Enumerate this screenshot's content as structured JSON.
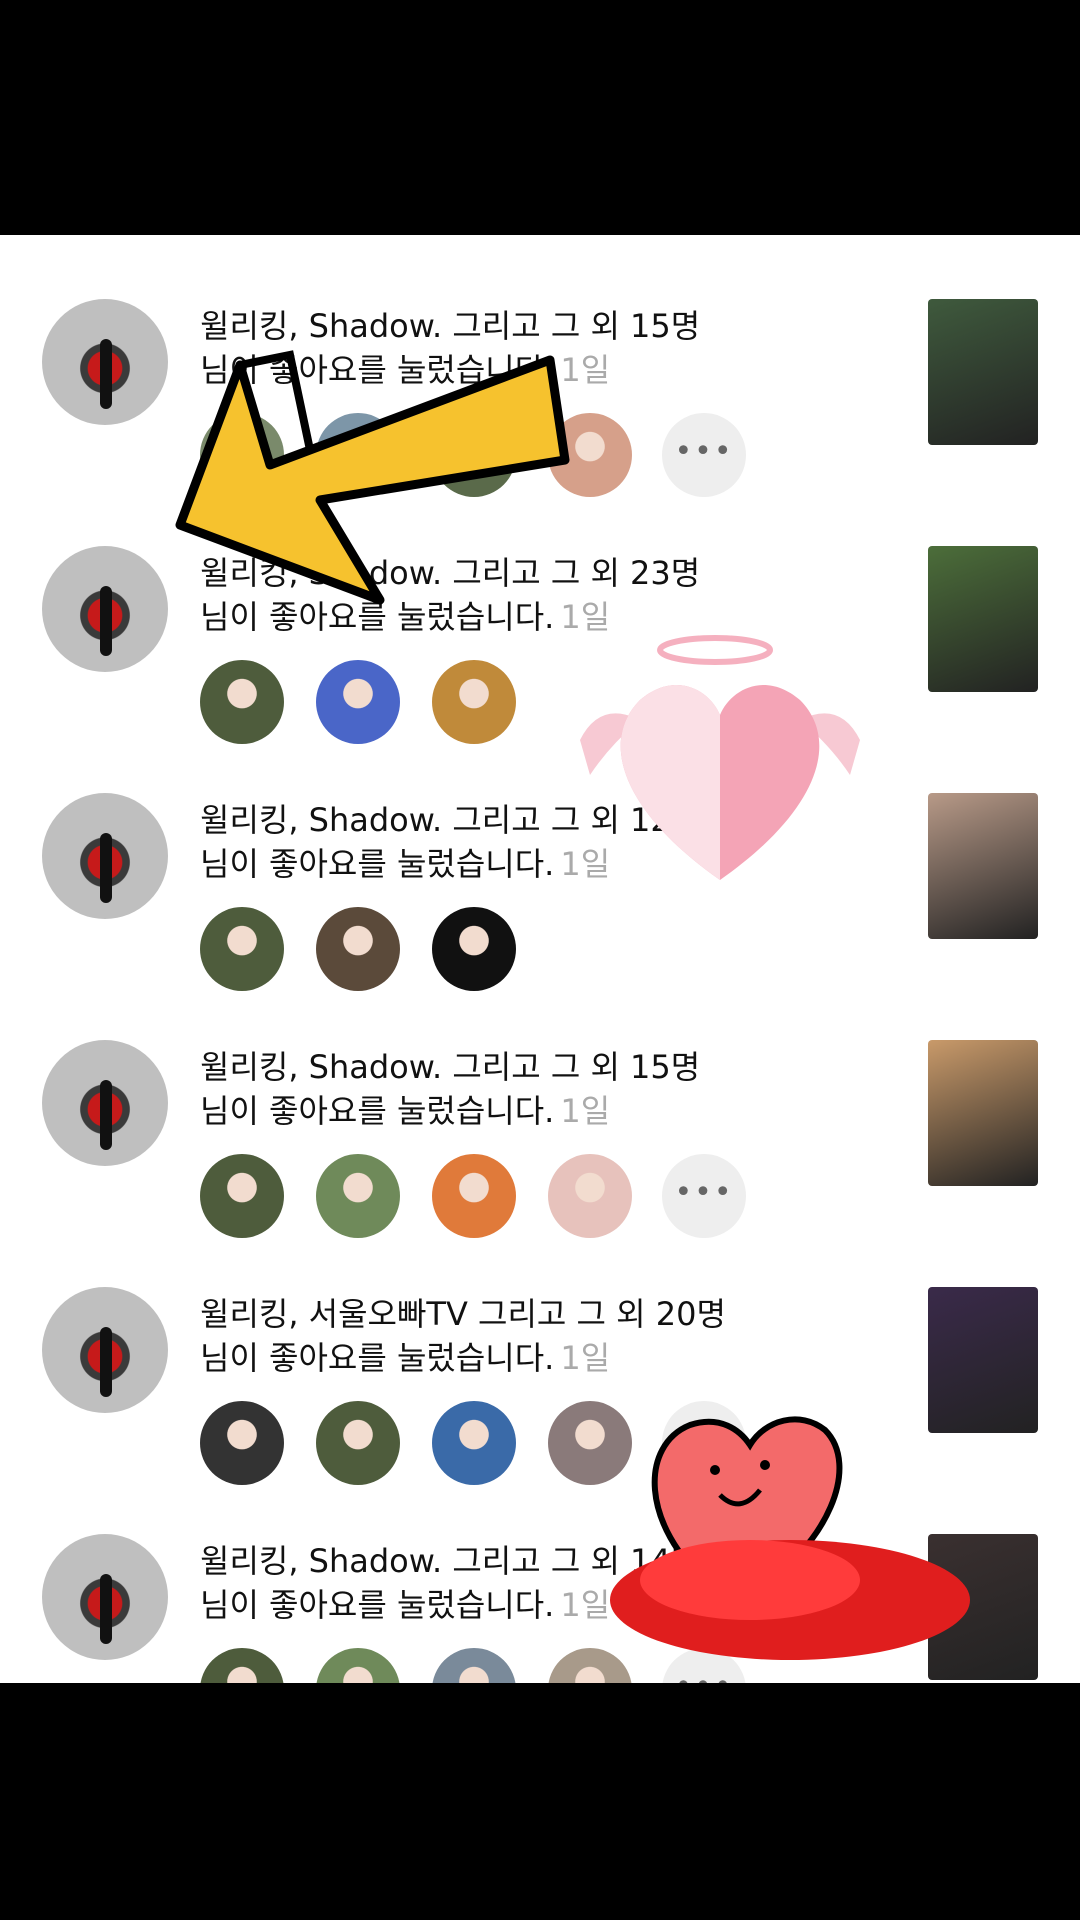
{
  "notifications": [
    {
      "title": "윌리킹, Shadow. 그리고 그 외 15명",
      "subtitle": "님이 좋아요를 눌렀습니다.",
      "time": "1일",
      "show_more": true,
      "likers": [
        "#7a8a6b",
        "#7d96a8",
        "#5a6a4a",
        "#d6a08a"
      ],
      "thumb": "#3f5a3d"
    },
    {
      "title": "윌리킹, Shadow. 그리고 그 외 23명",
      "subtitle": "님이 좋아요를 눌렀습니다.",
      "time": "1일",
      "show_more": false,
      "likers": [
        "#4e5c3c",
        "#4a66c8",
        "#c08a3a"
      ],
      "thumb": "#4c6e3a"
    },
    {
      "title": "윌리킹, Shadow. 그리고 그 외 12명",
      "subtitle": "님이 좋아요를 눌렀습니다.",
      "time": "1일",
      "show_more": false,
      "likers": [
        "#4e5c3c",
        "#5b4a3a",
        "#111111"
      ],
      "thumb": "#b89a88"
    },
    {
      "title": "윌리킹, Shadow. 그리고 그 외 15명",
      "subtitle": "님이 좋아요를 눌렀습니다.",
      "time": "1일",
      "show_more": true,
      "likers": [
        "#4e5c3c",
        "#6f8a5a",
        "#e07a3a",
        "#e7c2bc"
      ],
      "thumb": "#c99a6a"
    },
    {
      "title": "윌리킹, 서울오빠TV 그리고 그 외 20명",
      "subtitle": "님이 좋아요를 눌렀습니다.",
      "time": "1일",
      "show_more": true,
      "likers": [
        "#333333",
        "#4e5c3c",
        "#3a6aa8",
        "#8a7a7a"
      ],
      "thumb": "#3a2a4a"
    },
    {
      "title": "윌리킹, Shadow. 그리고 그 외 14명",
      "subtitle": "님이 좋아요를 눌렀습니다.",
      "time": "1일",
      "show_more": true,
      "likers": [
        "#4e5c3c",
        "#6f8a5a",
        "#7a8a9a",
        "#a89a8a"
      ],
      "thumb": "#3a3030"
    }
  ]
}
